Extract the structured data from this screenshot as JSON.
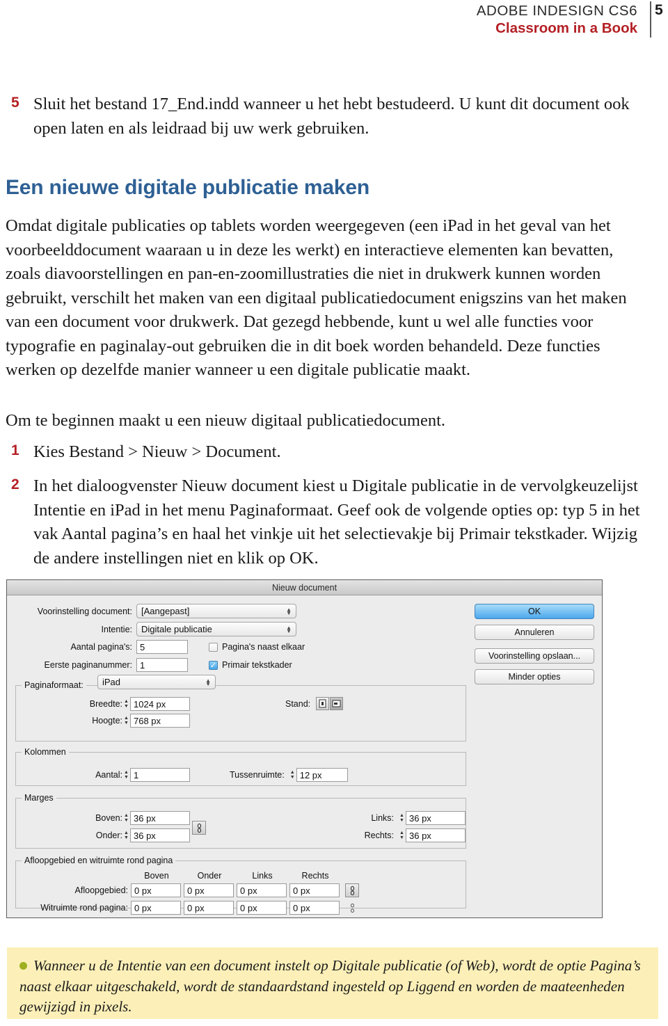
{
  "header": {
    "line1": "ADOBE INDESIGN CS6",
    "line2": "Classroom in a Book",
    "page_number": "5",
    "accent_red": "#b42025"
  },
  "content": {
    "step5_num": "5",
    "step5_text": "Sluit het bestand 17_End.indd wanneer u het hebt bestudeerd. U kunt dit document ook open laten en als leidraad bij uw werk gebruiken.",
    "heading": "Een nieuwe digitale publicatie maken",
    "heading_color": "#2e6094",
    "para1": "Omdat digitale publicaties op tablets worden weergegeven (een iPad in het geval van het voorbeelddocument waaraan u in deze les werkt) en interactieve elementen kan bevatten, zoals diavoorstellingen en pan-en-zoomillustraties die niet in drukwerk kunnen worden gebruikt, verschilt het maken van een digitaal publicatiedocument enigszins van het maken van een document voor drukwerk. Dat gezegd hebbende, kunt u wel alle functies voor typografie en paginalay-out gebruiken die in dit boek worden behandeld. Deze functies werken op dezelfde manier wanneer u een digitale publicatie maakt.",
    "para2": "Om te beginnen maakt u een nieuw digitaal publicatiedocument.",
    "step1_num": "1",
    "step1_text": "Kies Bestand > Nieuw > Document.",
    "step2_num": "2",
    "step2_text": "In het dialoogvenster Nieuw document kiest u Digitale publicatie in de vervolgkeuzelijst Intentie en iPad in het menu Paginaformaat. Geef ook de volgende opties op: typ 5 in het vak Aantal pagina’s en haal het vinkje uit het selectievakje bij Primair tekstkader. Wijzig de andere instellingen niet en klik op OK."
  },
  "dialog": {
    "title": "Nieuw document",
    "preset_label": "Voorinstelling document:",
    "preset_value": "[Aangepast]",
    "intent_label": "Intentie:",
    "intent_value": "Digitale publicatie",
    "pages_label": "Aantal pagina's:",
    "pages_value": "5",
    "firstpage_label": "Eerste paginanummer:",
    "firstpage_value": "1",
    "facing_pages_label": "Pagina's naast elkaar",
    "facing_pages_checked": false,
    "primary_frame_label": "Primair tekstkader",
    "primary_frame_checked": true,
    "pagesize_label": "Paginaformaat:",
    "pagesize_value": "iPad",
    "width_label": "Breedte:",
    "width_value": "1024 px",
    "height_label": "Hoogte:",
    "height_value": "768 px",
    "orientation_label": "Stand:",
    "orientation_portrait_icon": "portrait-icon",
    "orientation_landscape_icon": "landscape-icon",
    "columns_group": "Kolommen",
    "columns_count_label": "Aantal:",
    "columns_count_value": "1",
    "gutter_label": "Tussenruimte:",
    "gutter_value": "12 px",
    "margins_group": "Marges",
    "margin_top_label": "Boven:",
    "margin_top_value": "36 px",
    "margin_bottom_label": "Onder:",
    "margin_bottom_value": "36 px",
    "margin_left_label": "Links:",
    "margin_left_value": "36 px",
    "margin_right_label": "Rechts:",
    "margin_right_value": "36 px",
    "bleed_group": "Afloopgebied en witruimte rond pagina",
    "col_top": "Boven",
    "col_bottom": "Onder",
    "col_left": "Links",
    "col_right": "Rechts",
    "bleed_label": "Afloopgebied:",
    "bleed_values": [
      "0 px",
      "0 px",
      "0 px",
      "0 px"
    ],
    "slug_label": "Witruimte rond pagina:",
    "slug_values": [
      "0 px",
      "0 px",
      "0 px",
      "0 px"
    ],
    "buttons": {
      "ok": "OK",
      "cancel": "Annuleren",
      "save_preset": "Voorinstelling opslaan...",
      "fewer_options": "Minder opties"
    }
  },
  "note": {
    "text": "Wanneer u de Intentie van een document instelt op Digitale publicatie (of Web), wordt de optie Pagina’s naast elkaar uitgeschakeld, wordt de standaardstand ingesteld op Liggend en worden de maateenheden gewijzigd in pixels.",
    "bullet_color": "#9fb021",
    "background": "#fcf0b8"
  }
}
